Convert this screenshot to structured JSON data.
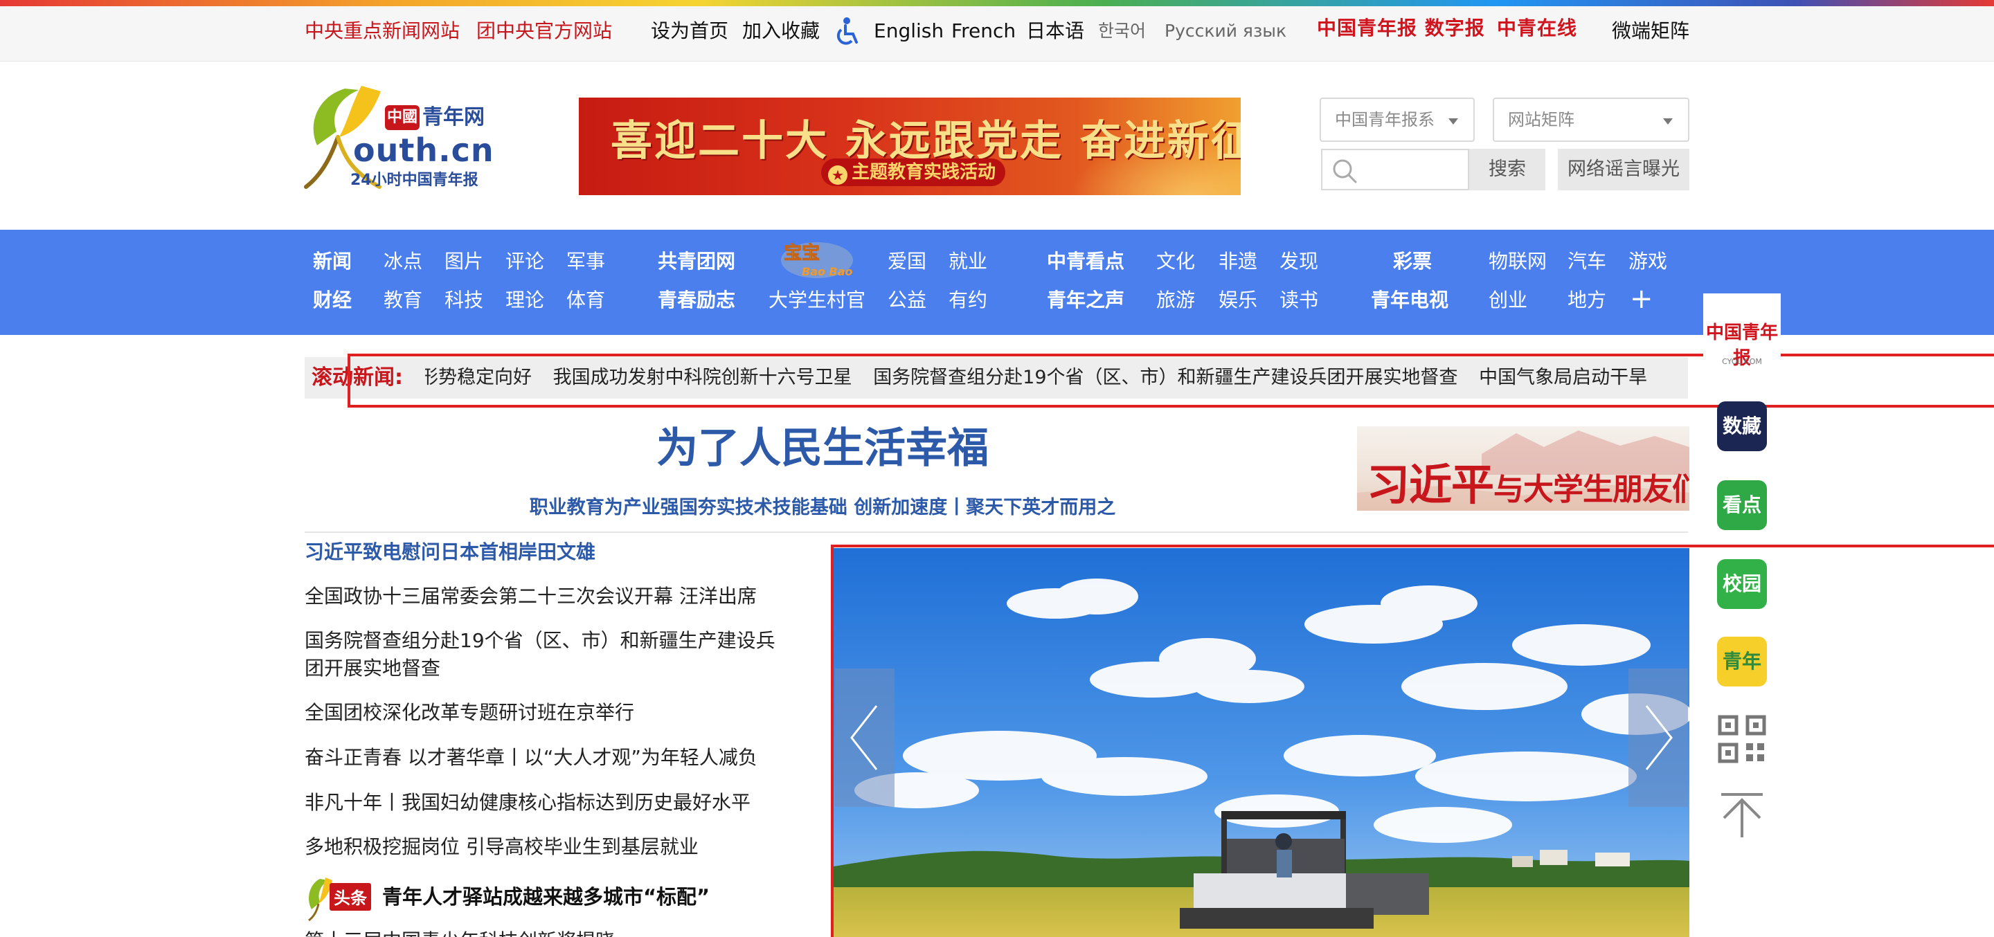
{
  "topbar": {
    "links_left": [
      "中央重点新闻网站",
      "团中央官方网站"
    ],
    "links_mid": [
      "设为首页",
      "加入收藏"
    ],
    "languages": [
      "English",
      "French",
      "日本语",
      "한국어",
      "Русский язык"
    ],
    "brand_digital": "中国青年报 数字报",
    "brand_online": "中青在线",
    "matrix": "微端矩阵"
  },
  "logo": {
    "cn_badge": "中國",
    "site_name": "青年网",
    "domain": "outh.cn",
    "tagline": "24小时中国青年报"
  },
  "banner": {
    "title": "喜迎二十大  永远跟党走  奋进新征程",
    "subtitle": "主题教育实践活动"
  },
  "header_controls": {
    "select1": "中国青年报系",
    "select2": "网站矩阵",
    "search_placeholder": "",
    "search_button": "搜索",
    "rumor_button": "网络谣言曝光"
  },
  "nav": {
    "col1": [
      "新闻",
      "财经"
    ],
    "col2": [
      "冰点",
      "教育"
    ],
    "col3": [
      "图片",
      "科技"
    ],
    "col4": [
      "评论",
      "理论"
    ],
    "col5": [
      "军事",
      "体育"
    ],
    "col6": [
      "共青团网",
      "青春励志"
    ],
    "col7": [
      "宝宝",
      "大学生村官"
    ],
    "col8": [
      "爱国",
      "公益"
    ],
    "col9": [
      "就业",
      "有约"
    ],
    "col10": [
      "中青看点",
      "青年之声"
    ],
    "col11": [
      "文化",
      "旅游"
    ],
    "col12": [
      "非遗",
      "娱乐"
    ],
    "col13": [
      "发现",
      "读书"
    ],
    "col14": [
      "彩票",
      "青年电视"
    ],
    "col15": [
      "物联网",
      "创业"
    ],
    "col16": [
      "汽车",
      "地方"
    ],
    "col17": [
      "游戏",
      "+"
    ]
  },
  "ticker": {
    "label": "滚动新闻:",
    "items": [
      "形势稳定向好",
      "我国成功发射中科院创新十六号卫星",
      "国务院督查组分赴19个省（区、市）和新疆生产建设兵团开展实地督查",
      "中国气象局启动干旱"
    ]
  },
  "headline": {
    "title": "为了人民生活幸福",
    "subtitle": "职业教育为产业强国夯实技术技能基础 创新加速度丨聚天下英才而用之"
  },
  "xi_banner": {
    "main": "习近平",
    "rest": "与大学生朋友们"
  },
  "news_list": [
    "习近平致电慰问日本首相岸田文雄",
    "全国政协十三届常委会第二十三次会议开幕 汪洋出席",
    "国务院督查组分赴19个省（区、市）和新疆生产建设兵团开展实地督查",
    "全国团校深化改革专题研讨班在京举行",
    "奋斗正青春 以才著华章丨以“大人才观”为年轻人减负",
    "非凡十年丨我国妇幼健康核心指标达到历史最好水平",
    "多地积极挖掘岗位 引导高校毕业生到基层就业"
  ],
  "toutiao": {
    "badge": "头条",
    "text": "青年人才驿站成越来越多城市“标配”",
    "cut": "第十三届中国青少年科技创新奖揭晓"
  },
  "sidebar": {
    "cyol_title": "中国青年报",
    "cyol_domain": "CYOL.COM",
    "apps": [
      "数藏",
      "看点",
      "校园",
      "青年"
    ]
  },
  "colors": {
    "brand_red": "#c8161d",
    "nav_blue": "#4a7fed",
    "headline_blue": "#2d5aa8"
  }
}
